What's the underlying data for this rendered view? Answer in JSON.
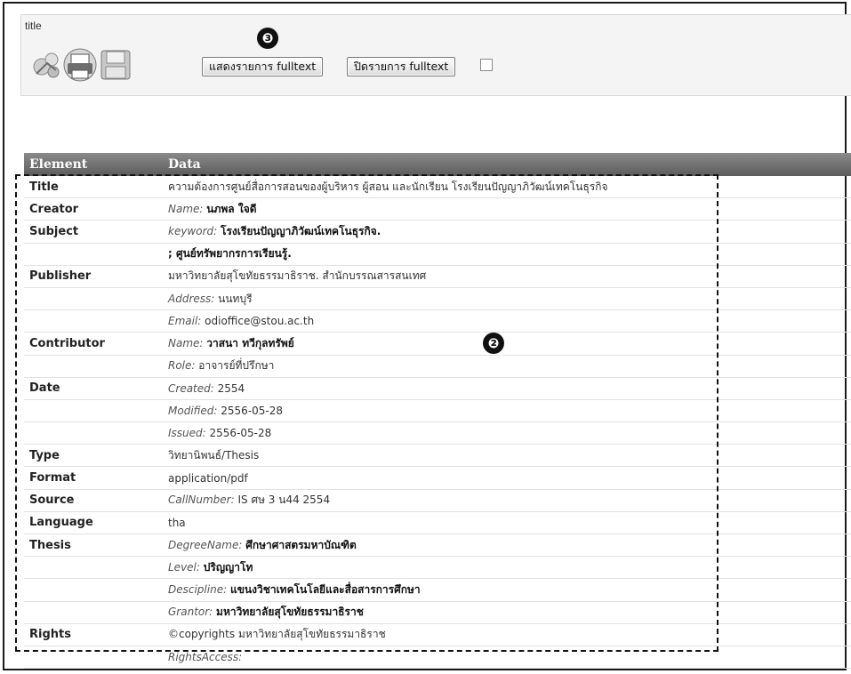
{
  "header": {
    "title": "title",
    "show_fulltext_button": "แสดงรายการ fulltext",
    "hide_fulltext_button": "ปิดรายการ fulltext",
    "badge_buttons": "❸",
    "badge_table": "❷"
  },
  "table": {
    "columns": [
      "Element",
      "Data"
    ],
    "rows": [
      {
        "element": "Title",
        "label": "",
        "value": "ความต้องการศูนย์สื่อการสอนของผู้บริหาร ผู้สอน และนักเรียน โรงเรียนปัญญาภิวัฒน์เทคโนธุรกิจ",
        "bold": false
      },
      {
        "element": "Creator",
        "label": "Name:",
        "value": "นภพล ใจดี",
        "bold": true
      },
      {
        "element": "Subject",
        "label": "keyword:",
        "value": "โรงเรียนปัญญาภิวัฒน์เทคโนธุรกิจ.",
        "bold": true
      },
      {
        "element": "",
        "label": "",
        "value": "; ศูนย์ทรัพยากรการเรียนรู้.",
        "bold": true
      },
      {
        "element": "Publisher",
        "label": "",
        "value": "มหาวิทยาลัยสุโขทัยธรรมาธิราช. สำนักบรรณสารสนเทศ",
        "bold": false
      },
      {
        "element": "",
        "label": "Address:",
        "value": "นนทบุรี",
        "bold": false
      },
      {
        "element": "",
        "label": "Email:",
        "value": "odioffice@stou.ac.th",
        "bold": false
      },
      {
        "element": "Contributor",
        "label": "Name:",
        "value": "วาสนา ทวีกุลทรัพย์",
        "bold": true
      },
      {
        "element": "",
        "label": "Role:",
        "value": "อาจารย์ที่ปรึกษา",
        "bold": false
      },
      {
        "element": "Date",
        "label": "Created:",
        "value": "2554",
        "bold": false
      },
      {
        "element": "",
        "label": "Modified:",
        "value": "2556-05-28",
        "bold": false
      },
      {
        "element": "",
        "label": "Issued:",
        "value": "2556-05-28",
        "bold": false
      },
      {
        "element": "Type",
        "label": "",
        "value": "วิทยานิพนธ์/Thesis",
        "bold": false
      },
      {
        "element": "Format",
        "label": "",
        "value": "application/pdf",
        "bold": false
      },
      {
        "element": "Source",
        "label": "CallNumber:",
        "value": "IS ศษ 3 น44 2554",
        "bold": false
      },
      {
        "element": "Language",
        "label": "",
        "value": "tha",
        "bold": false
      },
      {
        "element": "Thesis",
        "label": "DegreeName:",
        "value": "ศึกษาศาสตรมหาบัณฑิต",
        "bold": true
      },
      {
        "element": "",
        "label": "Level:",
        "value": "ปริญญาโท",
        "bold": true
      },
      {
        "element": "",
        "label": "Descipline:",
        "value": "แขนงวิชาเทคโนโลยีและสื่อสารการศึกษา",
        "bold": true
      },
      {
        "element": "",
        "label": "Grantor:",
        "value": "มหาวิทยาลัยสุโขทัยธรรมาธิราช",
        "bold": true
      },
      {
        "element": "Rights",
        "label": "",
        "value": "©copyrights มหาวิทยาลัยสุโขทัยธรรมาธิราช",
        "bold": false
      },
      {
        "element": "",
        "label": "RightsAccess:",
        "value": "",
        "bold": false
      }
    ]
  },
  "icons": [
    "share-icon",
    "print-icon",
    "save-icon"
  ]
}
